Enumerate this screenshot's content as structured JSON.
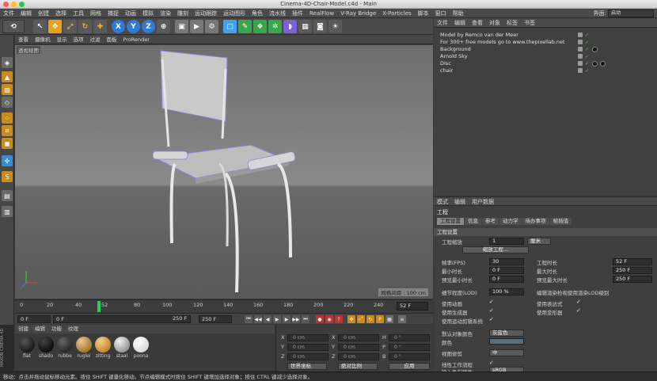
{
  "window": {
    "title": "Cinema-4D-Chair-Model.c4d - Main"
  },
  "menubar": {
    "items": [
      "文件",
      "编辑",
      "创建",
      "选择",
      "工具",
      "网格",
      "捕捉",
      "动画",
      "模拟",
      "渲染",
      "雕刻",
      "运动跟踪",
      "运动图形",
      "角色",
      "流水线",
      "插件",
      "RealFlow",
      "V-Ray Bridge",
      "X-Particles",
      "脚本",
      "窗口",
      "帮助"
    ],
    "layout_label": "界面:",
    "layout_value": "启动"
  },
  "viewport": {
    "menu": [
      "查看",
      "摄像机",
      "显示",
      "选项",
      "过滤",
      "面板",
      "ProRender"
    ],
    "title": "透视视图",
    "grid_spacing": "网格间距 : 100 cm"
  },
  "timeline": {
    "ticks": [
      "0",
      "20",
      "40",
      "52",
      "80",
      "100",
      "120",
      "140",
      "160",
      "180",
      "200",
      "220",
      "240"
    ],
    "current_frame": "52 F",
    "playhead_frame": 52
  },
  "transport": {
    "start": "0 F",
    "preview_start": "0 F",
    "preview_end": "250 F",
    "end": "250 F"
  },
  "material_manager": {
    "menu": [
      "创建",
      "编辑",
      "功能",
      "纹理"
    ],
    "materials": [
      {
        "name": "flat",
        "color": "#1b1b1b"
      },
      {
        "name": "shado",
        "color": "#0f0f0f"
      },
      {
        "name": "rubbe",
        "color": "#2a2a2a"
      },
      {
        "name": "ruglei",
        "color": "#a77a36"
      },
      {
        "name": "zitting",
        "color": "#c7892e"
      },
      {
        "name": "staal",
        "color": "#9a9a9a"
      },
      {
        "name": "poona",
        "color": "#d9d9d9"
      }
    ],
    "brand": "MAXON CINEMA 4D"
  },
  "coordinates": {
    "rows": [
      {
        "a": "X",
        "av": "0 cm",
        "b": "X",
        "bv": "0 cm",
        "c": "H",
        "cv": "0 °"
      },
      {
        "a": "Y",
        "av": "0 cm",
        "b": "Y",
        "bv": "0 cm",
        "c": "P",
        "cv": "0 °"
      },
      {
        "a": "Z",
        "av": "0 cm",
        "b": "Z",
        "bv": "0 cm",
        "c": "B",
        "cv": "0 °"
      }
    ],
    "mode_select": "世界坐标",
    "scale_select": "绝对比例",
    "apply": "应用"
  },
  "status": "移动：点击并拖动鼠标移动元素。按住 SHIFT 键量化移动。节点编辑模式时按住 SHIFT 键增加选择对象；按住 CTRL 键减少选择对象。",
  "object_manager": {
    "menu": [
      "文件",
      "编辑",
      "查看",
      "对象",
      "标签",
      "书签"
    ],
    "rows": [
      {
        "name": "Model by Remco van der Meer"
      },
      {
        "name": "For 300+ free models go to www.thepixellab.net"
      },
      {
        "name": "Background"
      },
      {
        "name": "Arnold Sky"
      },
      {
        "name": "Disc"
      },
      {
        "name": "chair"
      }
    ]
  },
  "attribute_manager": {
    "menu": [
      "模式",
      "编辑",
      "用户数据"
    ],
    "title": "工程",
    "tabs": [
      "工程设置",
      "信息",
      "参考",
      "动力学",
      "待办事项",
      "帧插值"
    ],
    "active_tab": 0,
    "section": "工程设置",
    "scale_label": "工程缩放",
    "scale_value": "1",
    "scale_unit": "厘米",
    "scale_button": "缩放工程...",
    "fps_label": "帧率(FPS)",
    "fps_value": "30",
    "proj_len_label": "工程时长",
    "proj_len_value": "52 F",
    "min_time_label": "最小时长",
    "min_time_value": "0 F",
    "max_time_label": "最大时长",
    "max_time_value": "250 F",
    "prev_min_label": "预览最小时长",
    "prev_min_value": "0 F",
    "prev_max_label": "预览最大时长",
    "prev_max_value": "250 F",
    "lod_label": "细节程度(LOD)",
    "lod_value": "100 %",
    "lod_render_label": "编辑渲染检视使用渲染LOD级别",
    "use_anim": "使用动画",
    "use_expr": "使用表达式",
    "use_gen": "使用生成器",
    "use_deform": "使用变形器",
    "use_motion": "使用运动剪辑系统",
    "default_color_label": "默认对象颜色",
    "default_color_value": "灰蓝色",
    "color_label": "颜色",
    "view_clip_label": "视图修剪",
    "view_clip_value": "中",
    "linear_label": "线性工作流程",
    "input_color_label": "输入色彩特性",
    "input_color_value": "sRGB"
  }
}
